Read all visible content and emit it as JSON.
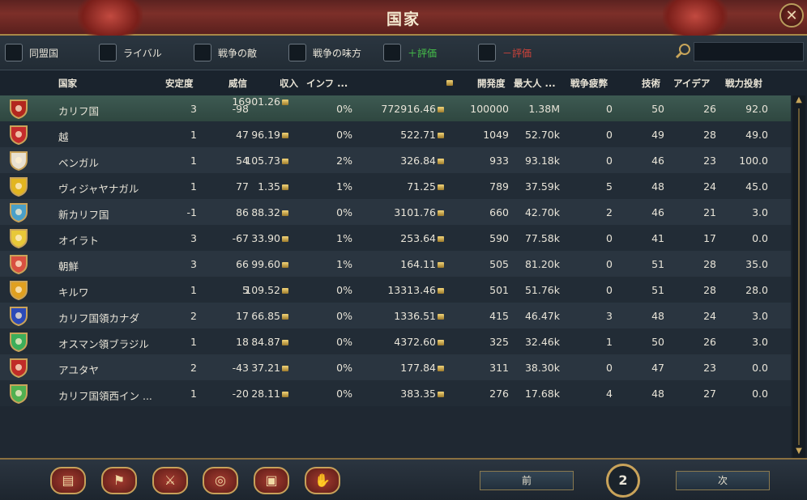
{
  "window": {
    "title": "国家",
    "close_icon": "close-icon"
  },
  "filters": [
    {
      "label": "同盟国",
      "type": "normal"
    },
    {
      "label": "ライバル",
      "type": "normal"
    },
    {
      "label": "戦争の敵",
      "type": "normal"
    },
    {
      "label": "戦争の味方",
      "type": "normal"
    },
    {
      "label": "＋評価",
      "type": "plus",
      "color": "#46c24a"
    },
    {
      "label": "－評価",
      "type": "minus",
      "color": "#d2433a"
    }
  ],
  "search": {
    "placeholder": "",
    "icon": "search-icon"
  },
  "columns": {
    "country": "国家",
    "stability": "安定度",
    "prestige": "威信",
    "income": "収入",
    "inflation": "インフ ...",
    "treasury_icon": "coin-icon",
    "development": "開発度",
    "max_manpower": "最大人 ...",
    "war_exhaustion": "戦争疲弊",
    "tech": "技術",
    "ideas": "アイデア",
    "army_commitment": "戦力投射"
  },
  "rows": [
    {
      "name": "カリフ国",
      "stability": "3",
      "prestige": "-98",
      "income": "16901.26",
      "inflation": "0%",
      "treasury": "772916.46",
      "development": "100000",
      "manpower": "1.38M",
      "war_exhaustion": "0",
      "tech": "50",
      "ideas": "26",
      "power": "92.0",
      "flag": "#b3261e",
      "selected": true
    },
    {
      "name": "越",
      "stability": "1",
      "prestige": "47",
      "income": "96.19",
      "inflation": "0%",
      "treasury": "522.71",
      "development": "1049",
      "manpower": "52.70k",
      "war_exhaustion": "0",
      "tech": "49",
      "ideas": "28",
      "power": "49.0",
      "flag": "#c42c2c"
    },
    {
      "name": "ベンガル",
      "stability": "1",
      "prestige": "54",
      "income": "105.73",
      "inflation": "2%",
      "treasury": "326.84",
      "development": "933",
      "manpower": "93.18k",
      "war_exhaustion": "0",
      "tech": "46",
      "ideas": "23",
      "power": "100.0",
      "flag": "#e8e0d0"
    },
    {
      "name": "ヴィジャヤナガル",
      "stability": "1",
      "prestige": "77",
      "income": "1.35",
      "inflation": "1%",
      "treasury": "71.25",
      "development": "789",
      "manpower": "37.59k",
      "war_exhaustion": "5",
      "tech": "48",
      "ideas": "24",
      "power": "45.0",
      "flag": "#e2b520"
    },
    {
      "name": "新カリフ国",
      "stability": "-1",
      "prestige": "86",
      "income": "88.32",
      "inflation": "0%",
      "treasury": "3101.76",
      "development": "660",
      "manpower": "42.70k",
      "war_exhaustion": "2",
      "tech": "46",
      "ideas": "21",
      "power": "3.0",
      "flag": "#4aa0c8"
    },
    {
      "name": "オイラト",
      "stability": "3",
      "prestige": "-67",
      "income": "33.90",
      "inflation": "1%",
      "treasury": "253.64",
      "development": "590",
      "manpower": "77.58k",
      "war_exhaustion": "0",
      "tech": "41",
      "ideas": "17",
      "power": "0.0",
      "flag": "#e8c838"
    },
    {
      "name": "朝鮮",
      "stability": "3",
      "prestige": "66",
      "income": "99.60",
      "inflation": "1%",
      "treasury": "164.11",
      "development": "505",
      "manpower": "81.20k",
      "war_exhaustion": "0",
      "tech": "51",
      "ideas": "28",
      "power": "35.0",
      "flag": "#d85040"
    },
    {
      "name": "キルワ",
      "stability": "1",
      "prestige": "5",
      "income": "109.52",
      "inflation": "0%",
      "treasury": "13313.46",
      "development": "501",
      "manpower": "51.76k",
      "war_exhaustion": "0",
      "tech": "51",
      "ideas": "28",
      "power": "28.0",
      "flag": "#e0a020"
    },
    {
      "name": "カリフ国領カナダ",
      "stability": "2",
      "prestige": "17",
      "income": "66.85",
      "inflation": "0%",
      "treasury": "1336.51",
      "development": "415",
      "manpower": "46.47k",
      "war_exhaustion": "3",
      "tech": "48",
      "ideas": "24",
      "power": "3.0",
      "flag": "#2c4ab8"
    },
    {
      "name": "オスマン領ブラジル",
      "stability": "1",
      "prestige": "18",
      "income": "84.87",
      "inflation": "0%",
      "treasury": "4372.60",
      "development": "325",
      "manpower": "32.46k",
      "war_exhaustion": "1",
      "tech": "50",
      "ideas": "26",
      "power": "3.0",
      "flag": "#3cae5a"
    },
    {
      "name": "アユタヤ",
      "stability": "2",
      "prestige": "-43",
      "income": "37.21",
      "inflation": "0%",
      "treasury": "177.84",
      "development": "311",
      "manpower": "38.30k",
      "war_exhaustion": "0",
      "tech": "47",
      "ideas": "23",
      "power": "0.0",
      "flag": "#c02c28"
    },
    {
      "name": "カリフ国領西イン ...",
      "stability": "1",
      "prestige": "-20",
      "income": "28.11",
      "inflation": "0%",
      "treasury": "383.35",
      "development": "276",
      "manpower": "17.68k",
      "war_exhaustion": "4",
      "tech": "48",
      "ideas": "27",
      "power": "0.0",
      "flag": "#50b050"
    }
  ],
  "bottom": {
    "tabs": [
      {
        "icon": "ledger-icon",
        "glyph": "▤"
      },
      {
        "icon": "flag-icon",
        "glyph": "⚑"
      },
      {
        "icon": "crossed-swords-icon",
        "glyph": "⚔"
      },
      {
        "icon": "coins-icon",
        "glyph": "◎"
      },
      {
        "icon": "trade-goods-icon",
        "glyph": "▣"
      },
      {
        "icon": "handshake-icon",
        "glyph": "✋"
      }
    ],
    "prev_label": "前",
    "page": "2",
    "next_label": "次"
  }
}
